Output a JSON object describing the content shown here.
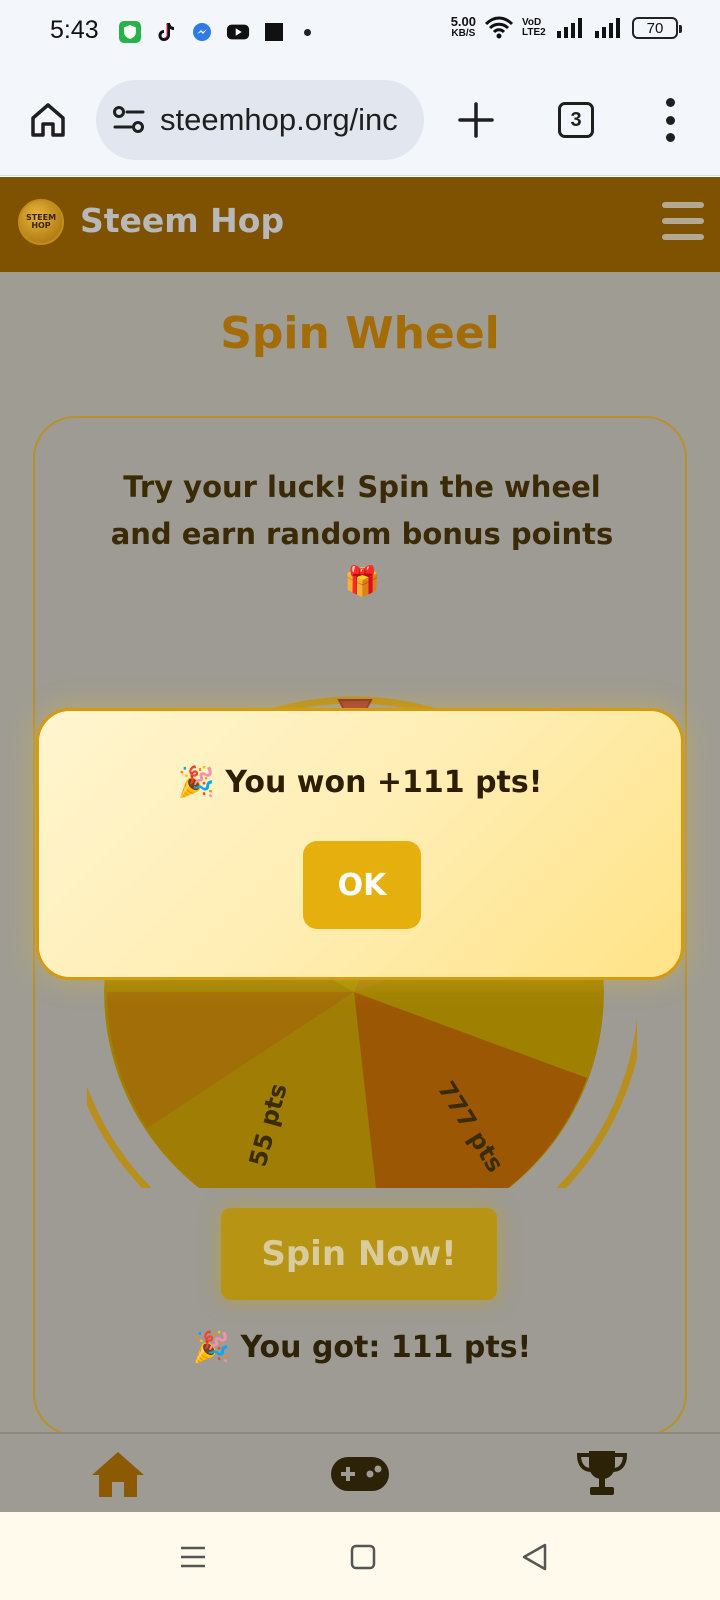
{
  "status_bar": {
    "time": "5:43",
    "net_speed_value": "5.00",
    "net_speed_unit": "KB/S",
    "volte": "VoD LTE2",
    "battery": "70",
    "app_icons": [
      "shield-app-icon",
      "tiktok-icon",
      "messenger-icon",
      "youtube-icon",
      "square-app-icon"
    ]
  },
  "browser": {
    "url": "steemhop.org/inc",
    "tab_count": "3"
  },
  "site": {
    "logo_text": "STEEM HOP",
    "title": "Steem Hop"
  },
  "page": {
    "title": "Spin Wheel",
    "intro": "Try your luck! Spin the wheel and earn random bonus points 🎁",
    "spin_button": "Spin Now!",
    "result": "🎉 You got: 111 pts!"
  },
  "wheel": {
    "visible_labels": [
      "pts",
      "55 pts",
      "777 pts"
    ],
    "colors": [
      "#a58f00",
      "#a46e0a",
      "#9c5704",
      "#a07d04"
    ]
  },
  "modal": {
    "message": "🎉 You won +111 pts!",
    "ok_label": "OK"
  },
  "bottom_nav": {
    "items": [
      "home-icon",
      "gamepad-icon",
      "trophy-icon"
    ],
    "active": "home-icon"
  },
  "colors": {
    "brand": "#7f5202",
    "accent": "#e5b00d",
    "title": "#a46c06"
  }
}
